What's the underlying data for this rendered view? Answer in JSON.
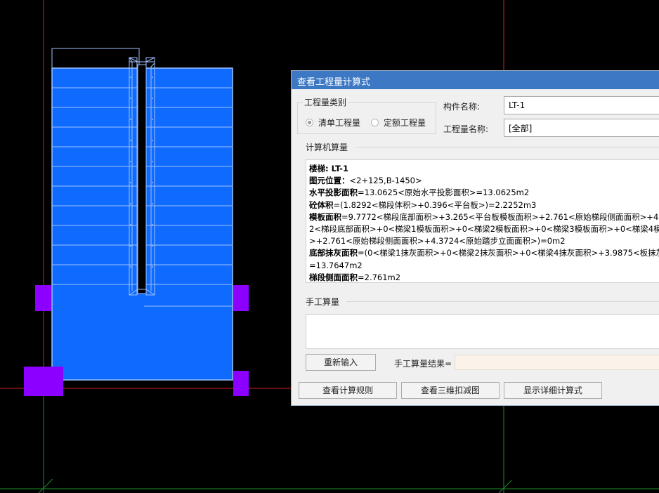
{
  "dialog": {
    "title": "查看工程量计算式",
    "quantity_type": {
      "label": "工程量类别",
      "options": [
        "清单工程量",
        "定额工程量"
      ],
      "selected": "清单工程量"
    },
    "component_name_label": "构件名称:",
    "component_name_value": "LT-1",
    "quantity_name_label": "工程量名称:",
    "quantity_name_value": "[全部]",
    "computer_calc_label": "计算机算量",
    "calc_lines": [
      {
        "key": "楼梯: LT-1",
        "rest": ""
      },
      {
        "key": "图元位置：",
        "rest": "<2+125,B-1450>"
      },
      {
        "key": "水平投影面积",
        "rest": "=13.0625<原始水平投影面积>=13.0625m2"
      },
      {
        "key": "砼体积",
        "rest": "=(1.8292<梯段体积>+0.396<平台板>)=2.2252m3"
      },
      {
        "key": "模板面积",
        "rest": "=9.7772<梯段底部面积>+3.265<平台板模板面积>+2.761<原始梯段侧面面积>+4."
      },
      {
        "key": "",
        "rest": "2<梯段底部面积>+0<梯梁1模板面积>+0<梯梁2模板面积>+0<梯梁3模板面积>+0<梯梁4模"
      },
      {
        "key": "",
        "rest": ">+2.761<原始梯段侧面面积>+4.3724<原始踏步立面面积>)=0m2"
      },
      {
        "key": "底部抹灰面积",
        "rest": "=(0<梯梁1抹灰面积>+0<梯梁2抹灰面积>+0<梯梁4抹灰面积>+3.9875<板抹灰"
      },
      {
        "key": "",
        "rest": "=13.7647m2"
      },
      {
        "key": "梯段侧面面积",
        "rest": "=2.761m2"
      }
    ],
    "manual_calc_label": "手工算量",
    "reenter_button": "重新输入",
    "manual_result_label": "手工算量结果=",
    "manual_result_value": "",
    "buttons": {
      "view_rules": "查看计算规则",
      "view_3d": "查看三维扣减图",
      "show_detail": "显示详细计算式"
    }
  },
  "colors": {
    "canvas_bg": "#000000",
    "stair_fill": "#0f6bff",
    "stair_outline": "#9fc2ff",
    "column": "#8b00ff",
    "axis_red": "#d8202a",
    "axis_green": "#1e8c2e",
    "titlebar": "#3c78c3"
  }
}
